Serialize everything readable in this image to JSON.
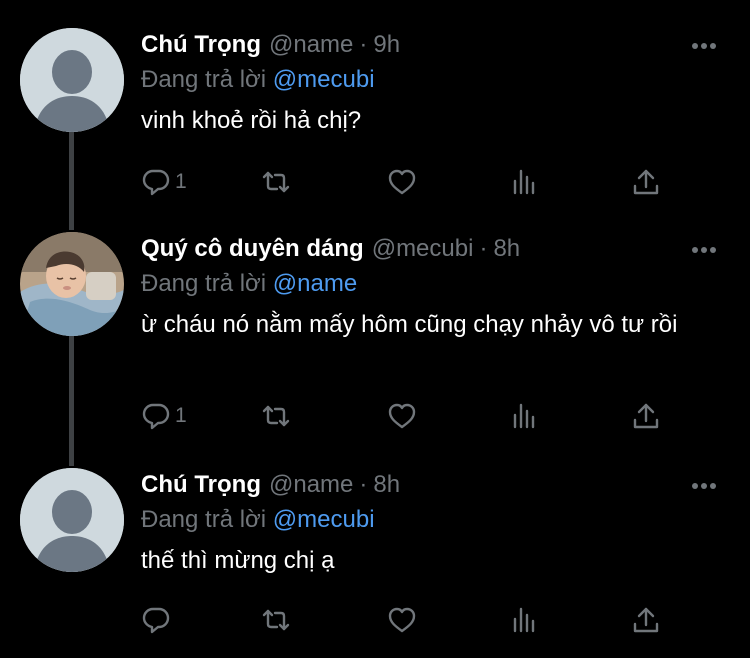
{
  "reply_prefix": "Đang trả lời",
  "tweets": [
    {
      "author": "Chú Trọng",
      "handle": "@name",
      "dot": "·",
      "time": "9h",
      "reply_to": "@mecubi",
      "text": "vinh khoẻ rồi hả chị?",
      "reply_count": "1",
      "avatar": "default"
    },
    {
      "author": "Quý cô duyên dáng",
      "handle": "@mecubi",
      "dot": "·",
      "time": "8h",
      "reply_to": "@name",
      "text": "ừ cháu nó nằm mấy hôm cũng chạy nhảy vô tư rồi",
      "reply_count": "1",
      "avatar": "photo-sleeping-baby"
    },
    {
      "author": "Chú Trọng",
      "handle": "@name",
      "dot": "·",
      "time": "8h",
      "reply_to": "@mecubi",
      "text": "thế thì mừng chị ạ",
      "reply_count": "",
      "avatar": "default"
    }
  ],
  "icons": {
    "more": "more-horizontal-icon",
    "reply": "reply-icon",
    "retweet": "retweet-icon",
    "like": "heart-icon",
    "views": "analytics-icon",
    "share": "share-icon"
  },
  "colors": {
    "background": "#000000",
    "text": "#ffffff",
    "muted": "#71767b",
    "link": "#4e9bf0",
    "thread_line": "#3e4144",
    "default_avatar": "#cfd9de"
  }
}
